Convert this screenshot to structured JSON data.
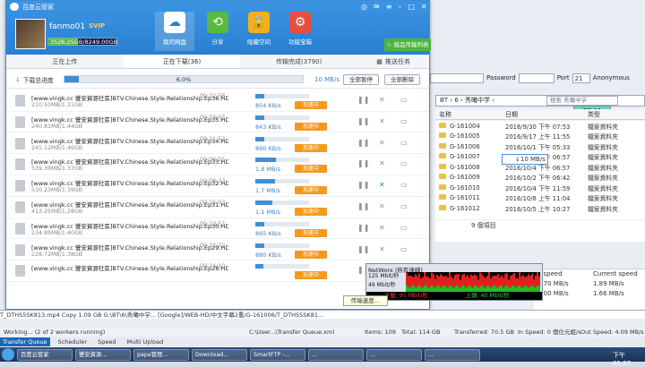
{
  "background": {
    "ftp_fields": {
      "field1": "21",
      "password_label": "Password",
      "port_label": "Port",
      "port": "21",
      "anon": "Anonymous"
    },
    "address": "BT  ›  6  ›  秀曦中学  ›",
    "search_placeholder": "搜索 秀曦中学",
    "cols": {
      "name": "名称",
      "date": "日期",
      "type": "类型"
    },
    "ok_badge": "OB 11",
    "folders": [
      {
        "name": "G-161004",
        "date": "2016/9/30 下午 07:53",
        "type": "檔案資料夾"
      },
      {
        "name": "G-161005",
        "date": "2016/9/17 上午 11:55",
        "type": "檔案資料夾"
      },
      {
        "name": "G-161006",
        "date": "2016/10/1 下午 05:33",
        "type": "檔案資料夾"
      },
      {
        "name": "G-161007",
        "date": "2016/10/4 下午 06:57",
        "type": "檔案資料夾"
      },
      {
        "name": "G-161008",
        "date": "2016/10/4 下午 06:57",
        "type": "檔案資料夾"
      },
      {
        "name": "G-161009",
        "date": "2016/10/2 下午 06:42",
        "type": "檔案資料夾"
      },
      {
        "name": "G-161010",
        "date": "2016/10/4 下午 11:59",
        "type": "檔案資料夾"
      },
      {
        "name": "G-161011",
        "date": "2016/10/8 上午 11:04",
        "type": "檔案資料夾"
      },
      {
        "name": "G-161012",
        "date": "2016/10/5 上午 10:27",
        "type": "檔案資料夾"
      }
    ],
    "item_count": "9 個項目",
    "net_popup": "↓10 MB/s",
    "speed_headers": [
      "e speed",
      "Current speed"
    ],
    "speed_rows": [
      [
        "2.70 MB/s",
        "1.89 MB/s"
      ],
      [
        "2.00 MB/s",
        "1.66 MB/s"
      ]
    ]
  },
  "app": {
    "title": "百度云管家",
    "user": "fanmo01",
    "vip": "SVIP",
    "quota": "3526.25GB/8249.00GB",
    "quota_fraction": 0.43,
    "nav": [
      {
        "label": "我的网盘",
        "icon": "cloud-icon"
      },
      {
        "label": "分享",
        "icon": "share-icon"
      },
      {
        "label": "隐藏空间",
        "icon": "lock-icon"
      },
      {
        "label": "功能宝箱",
        "icon": "toolbox-icon"
      }
    ],
    "send_btn": "☆ 极品传输列表",
    "tabs": {
      "upload": "正在上传",
      "downloading": "正在下载(36)",
      "done": "传输完成(3790)",
      "task": "推送任务"
    },
    "total_label": "下载总进度",
    "total_progress": "6.0%",
    "total_fraction": 0.06,
    "total_speed": "10 MB/s",
    "pause_all": "全部暂停",
    "delete_all": "全部删除",
    "accel": "加速中",
    "rows": [
      {
        "name": "[www.vingk.cc 豐安資源社區]BTV.Chinese.Style.Relationship.Ep36.HD...",
        "size": "210.50MB/1.31GB",
        "time": "00:22:58",
        "speed": "854 KB/s",
        "p": 0.16
      },
      {
        "name": "[www.vingk.cc 豐安資源社區]BTV.Chinese.Style.Relationship.Ep35.HD...",
        "size": "240.81MB/1.44GB",
        "time": "00:24:07",
        "speed": "843 KB/s",
        "p": 0.17
      },
      {
        "name": "[www.vingk.cc 豐安資源社區]BTV.Chinese.Style.Relationship.Ep34.HD...",
        "size": "245.12MB/1.46GB",
        "time": "00:21:52",
        "speed": "890 KB/s",
        "p": 0.17
      },
      {
        "name": "[www.vingk.cc 豐安資源社區]BTV.Chinese.Style.Relationship.Ep33.HD...",
        "size": "539.39MB/1.37GB",
        "time": "00:06:55",
        "speed": "1.8 MB/s",
        "p": 0.39
      },
      {
        "name": "[www.vingk.cc 豐安資源社區]BTV.Chinese.Style.Relationship.Ep32.HD...",
        "size": "510.23MB/1.39GB",
        "time": "00:08:33",
        "speed": "1.7 MB/s",
        "p": 0.36
      },
      {
        "name": "[www.vingk.cc 豐安資源社區]BTV.Chinese.Style.Relationship.Ep31.HD...",
        "size": "413.25MB/1.28GB",
        "time": "00:15:03",
        "speed": "1.1 MB/s",
        "p": 0.32
      },
      {
        "name": "[www.vingk.cc 豐安資源社區]BTV.Chinese.Style.Relationship.Ep30.HD...",
        "size": "234.89MB/1.40GB",
        "time": "00:23:57",
        "speed": "865 KB/s",
        "p": 0.17
      },
      {
        "name": "[www.vingk.cc 豐安資源社區]BTV.Chinese.Style.Relationship.Ep29.HD...",
        "size": "228.72MB/1.38GB",
        "time": "00:22:22",
        "speed": "880 KB/s",
        "p": 0.16
      },
      {
        "name": "[www.vingk.cc 豐安資源社區]BTV.Chinese.Style.Relationship.Ep28.HD...",
        "size": "",
        "time": "00:24:10",
        "speed": "",
        "p": 0.15
      }
    ]
  },
  "networx": {
    "title": "NetWorx (所有連線)",
    "scale_hi": "125 Mbit/秒",
    "scale_lo": "49 Mbit/秒",
    "down": "下載: 95 Mbit/秒",
    "up": "上傳: 40 Mbit/秒"
  },
  "tooltip": "传输速度…",
  "transfer_row": "T_DTHS5SK813.mp4        Copy        1.09 GB    G:\\BT\\6\\秀曦中学...    [Google]/WEB-HD/中文字幕2重/G-161006/T_DTHS5SK81...",
  "status": {
    "left": "Working... (2 of 2 workers running)",
    "mid": "C:\\User...\\Transfer Queue.xml",
    "items": "Items: 109",
    "total": "Total: 114 GB",
    "transferred": "Transferred: 70.5 GB",
    "inspeed": "In Speed: 0 個位元組/s",
    "outspeed": "Out Speed: 4.09 MB/s"
  },
  "queue_tabs": [
    "Transfer Queue",
    "Scheduler",
    "Speed",
    "Multi Upload"
  ],
  "taskbar": [
    "百度云管家",
    "豐安資源...",
    "papa管理...",
    "Download...",
    "SmartFTP -...",
    "...",
    "...",
    "..."
  ],
  "clock": "下午 01:27"
}
